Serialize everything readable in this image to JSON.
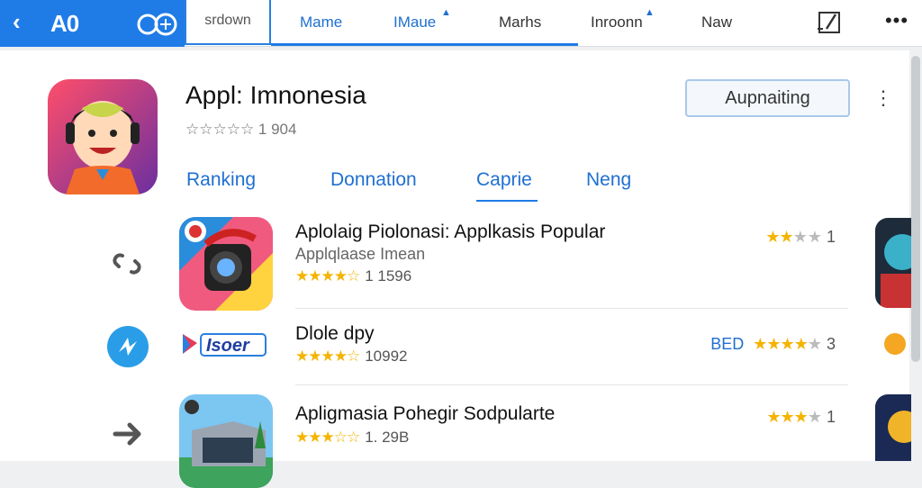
{
  "header": {
    "back_icon": "chevron-left-icon",
    "brand_title": "A0",
    "search_label": "srdown",
    "tabs": [
      "Mame",
      "IMaue",
      "Marhs",
      "Inroonn",
      "Naw"
    ],
    "edit_icon": "edit-icon",
    "more_label": "•••"
  },
  "app": {
    "title": "Appl: Imnonesia",
    "rating_text": "☆☆☆☆☆ 1 904",
    "install_label": "Aupnaiting",
    "kebab": "⋮"
  },
  "subtabs": [
    "Ranking",
    "Donnation",
    "Caprie",
    "Neng"
  ],
  "rows": [
    {
      "title": "Aplolaig Piolonasi: Applkasis Popular",
      "subtitle": "Applqlaase Imean",
      "stars": "★★★★☆",
      "count": "1 1596",
      "right_stars": "★★",
      "right_gray": "★★",
      "right_value": "1",
      "badge": ""
    },
    {
      "title": "Dlole dpy",
      "subtitle": "",
      "stars": "★★★★☆",
      "count": "10992",
      "right_stars": "★★★★",
      "right_gray": "★",
      "right_value": "3",
      "badge": "BED",
      "logo_text": "Isoer"
    },
    {
      "title": "Apligmasia Pohegir Sodpularte",
      "subtitle": "",
      "stars": "★★★☆☆",
      "count": "1. 29B",
      "right_stars": "★★★",
      "right_gray": "★",
      "right_value": "1",
      "badge": ""
    }
  ],
  "colors": {
    "accent": "#1f7be6",
    "star": "#f4b400"
  }
}
